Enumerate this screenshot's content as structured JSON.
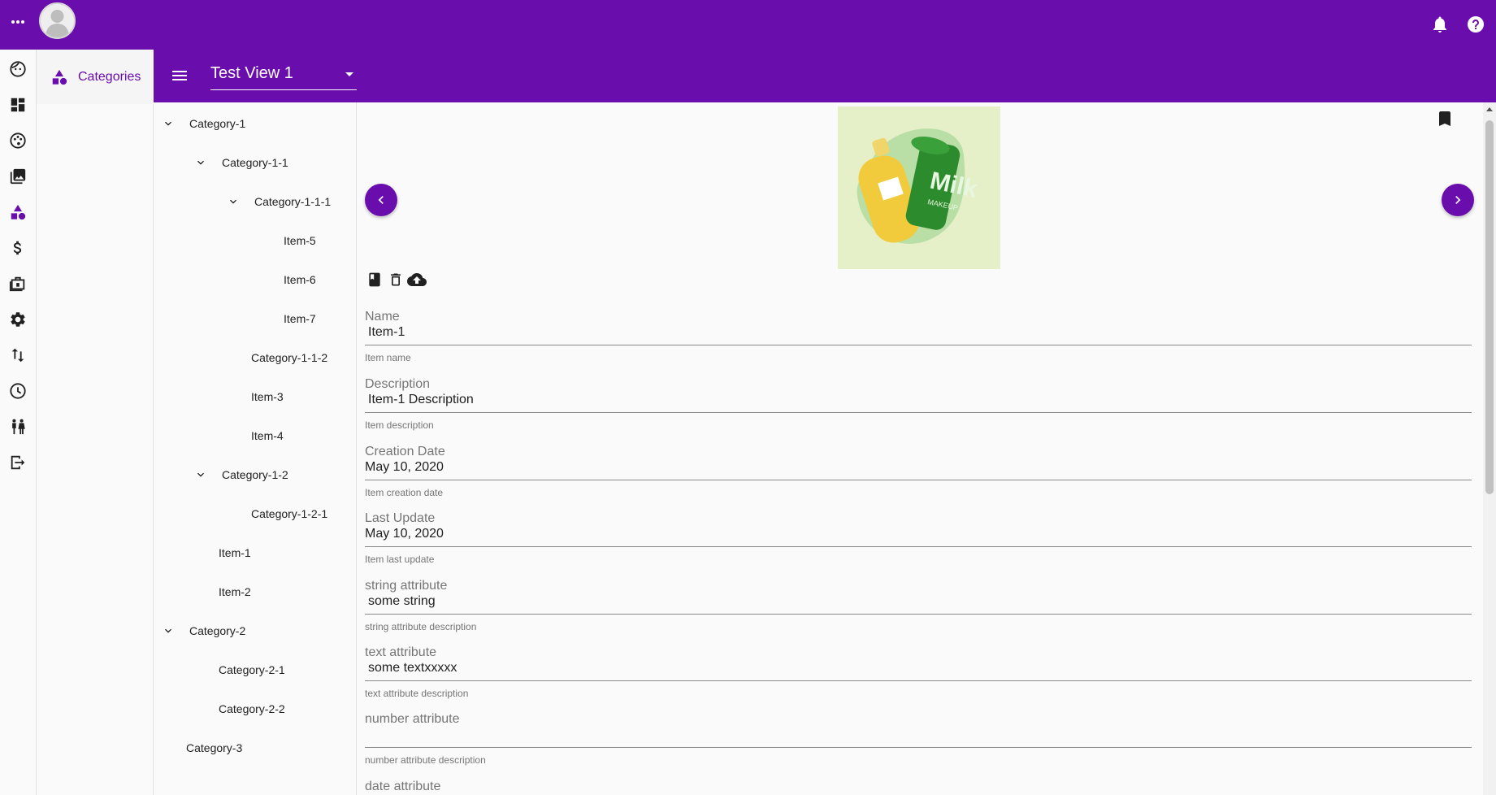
{
  "app": {
    "accent": "#6a0dad",
    "top_icons": [
      "more-horiz-icon",
      "avatar",
      "bell-icon",
      "help-icon"
    ]
  },
  "rail": {
    "icons": [
      "face-icon",
      "dashboard-icon",
      "palette-icon",
      "photo-library-icon",
      "category-icon",
      "dollar-icon",
      "portfolio-icon",
      "gear-icon",
      "sort-arrows-icon",
      "clock-icon",
      "people-icon",
      "logout-icon"
    ]
  },
  "subnav": {
    "categories_label": "Categories"
  },
  "header": {
    "view_label": "Test View 1"
  },
  "tree": [
    {
      "label": "Category-1",
      "level": 0,
      "expanded": true
    },
    {
      "label": "Category-1-1",
      "level": 1,
      "expanded": true
    },
    {
      "label": "Category-1-1-1",
      "level": 2,
      "expanded": true
    },
    {
      "label": "Item-5",
      "level": 3
    },
    {
      "label": "Item-6",
      "level": 3
    },
    {
      "label": "Item-7",
      "level": 3
    },
    {
      "label": "Category-1-1-2",
      "level": 2
    },
    {
      "label": "Item-3",
      "level": 2
    },
    {
      "label": "Item-4",
      "level": 2
    },
    {
      "label": "Category-1-2",
      "level": 1,
      "expanded": true
    },
    {
      "label": "Category-1-2-1",
      "level": 2
    },
    {
      "label": "Item-1",
      "level": 1
    },
    {
      "label": "Item-2",
      "level": 1
    },
    {
      "label": "Category-2",
      "level": 0,
      "expanded": true
    },
    {
      "label": "Category-2-1",
      "level": 1
    },
    {
      "label": "Category-2-2",
      "level": 1
    },
    {
      "label": "Category-3",
      "level": 0
    }
  ],
  "product": {
    "image_text": "Milk",
    "image_subtext": "MAKEUP"
  },
  "fields": [
    {
      "label": "Name",
      "value": "Item-1",
      "help": "Item name"
    },
    {
      "label": "Description",
      "value": "Item-1 Description",
      "help": "Item description"
    },
    {
      "label": "Creation Date",
      "value": "May 10, 2020",
      "help": "Item creation date"
    },
    {
      "label": "Last Update",
      "value": "May 10, 2020",
      "help": "Item last update"
    },
    {
      "label": "string attribute",
      "value": "some string",
      "help": "string attribute description"
    },
    {
      "label": "text attribute",
      "value": "some textxxxxx",
      "help": "text attribute description"
    },
    {
      "label": "number attribute",
      "value": "",
      "help": "number attribute description"
    },
    {
      "label": "date attribute",
      "value": "",
      "help": ""
    }
  ]
}
